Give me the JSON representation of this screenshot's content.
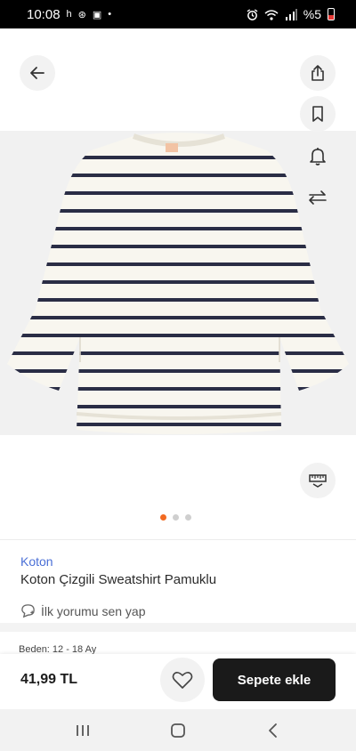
{
  "status_bar": {
    "time": "10:08",
    "indicators": [
      "h",
      "⊛",
      "▣",
      "•"
    ],
    "battery_text": "%5",
    "icons": [
      "alarm-icon",
      "wifi-icon",
      "signal-icon",
      "battery-icon"
    ]
  },
  "gallery": {
    "dots_count": 3,
    "active_dot": 0,
    "accent_dot_color": "#f26a21",
    "icons": [
      "back-arrow-icon",
      "share-icon",
      "bookmark-icon",
      "bell-icon",
      "compare-arrows-icon",
      "measure-icon"
    ]
  },
  "product": {
    "brand": "Koton",
    "title": "Koton Çizgili Sweatshirt Pamuklu",
    "review_cta": "İlk yorumu sen yap",
    "size_peek": "Beden: 12 - 18 Ay"
  },
  "bottom_bar": {
    "price": "41,99 TL",
    "add_to_cart": "Sepete ekle"
  },
  "colors": {
    "brand_link": "#4a6fd6",
    "cart_button": "#1a1a1a",
    "stripe": "#2a2d45",
    "fabric": "#f8f6ef"
  }
}
